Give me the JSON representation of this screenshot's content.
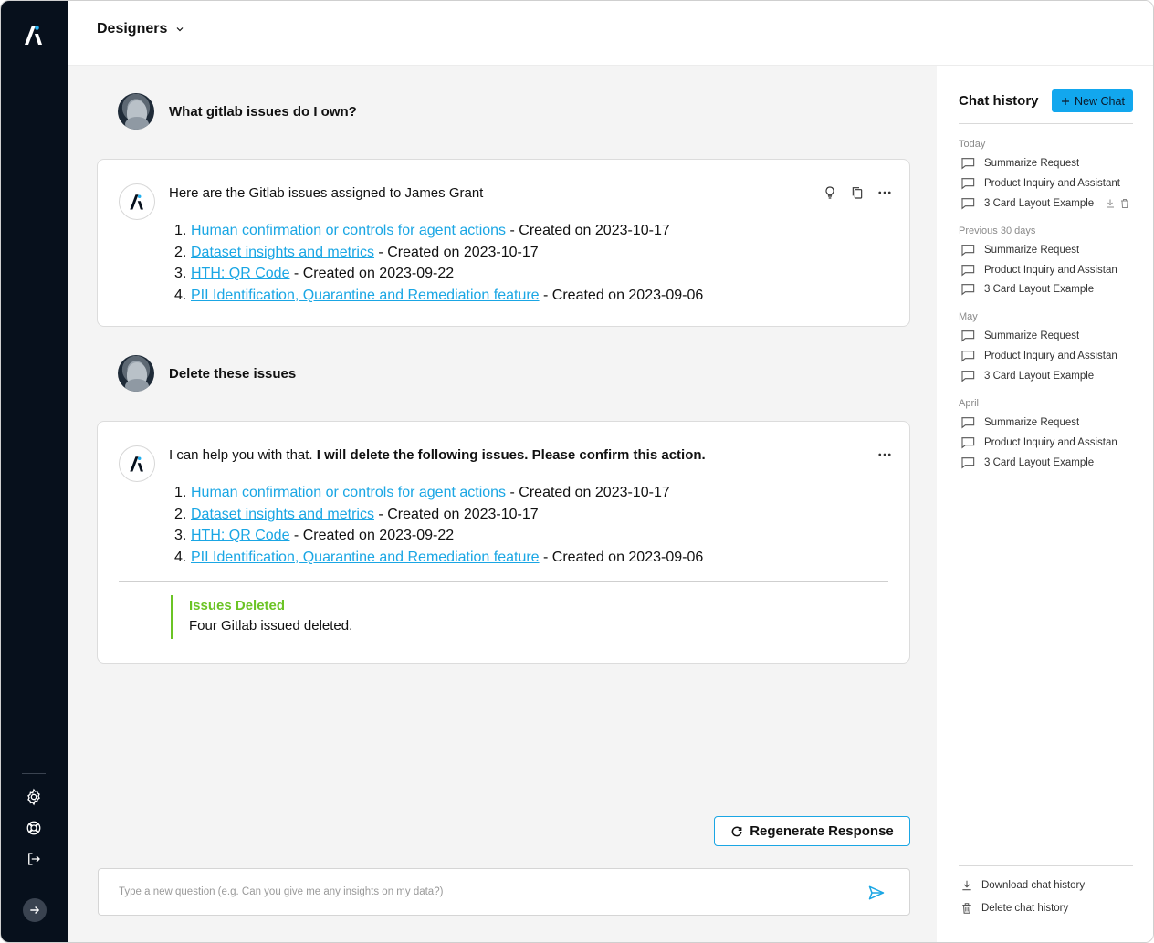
{
  "workspace": {
    "name": "Designers"
  },
  "conversation": {
    "first_question": "What gitlab issues do I own?",
    "first_answer": {
      "lead": "Here are the Gitlab issues assigned to James Grant",
      "issues": [
        {
          "num": "1.",
          "title": "Human confirmation or controls for agent actions",
          "meta": " - Created on 2023-10-17"
        },
        {
          "num": "2.",
          "title": "Dataset insights and metrics",
          "meta": " - Created on 2023-10-17"
        },
        {
          "num": "3.",
          "title": "HTH: QR Code",
          "meta": " - Created on 2023-09-22"
        },
        {
          "num": "4.",
          "title": "PII Identification, Quarantine and Remediation feature",
          "meta": " - Created on 2023-09-06"
        }
      ]
    },
    "second_question": "Delete these issues",
    "second_answer": {
      "lead_plain": "I can help you with that. ",
      "lead_bold": "I will delete the following issues. Please confirm this action.",
      "issues": [
        {
          "num": "1.",
          "title": "Human confirmation or controls for agent actions",
          "meta": " - Created on 2023-10-17"
        },
        {
          "num": "2.",
          "title": "Dataset insights and metrics",
          "meta": " - Created on 2023-10-17"
        },
        {
          "num": "3.",
          "title": "HTH: QR Code",
          "meta": " - Created on 2023-09-22"
        },
        {
          "num": "4.",
          "title": "PII Identification, Quarantine and Remediation feature",
          "meta": " - Created on 2023-09-06"
        }
      ],
      "status_title": "Issues Deleted",
      "status_desc": "Four Gitlab issued deleted."
    }
  },
  "regenerate_label": "Regenerate Response",
  "composer": {
    "placeholder": "Type a new question (e.g. Can you give me any insights on my data?)"
  },
  "sidebar": {
    "title": "Chat history",
    "new_chat_label": "New Chat",
    "groups": [
      {
        "label": "Today",
        "items": [
          "Summarize Request",
          "Product Inquiry and Assistant",
          "3 Card Layout Example"
        ]
      },
      {
        "label": "Previous 30 days",
        "items": [
          "Summarize Request",
          "Product Inquiry and Assistan",
          "3 Card Layout Example"
        ]
      },
      {
        "label": "May",
        "items": [
          "Summarize Request",
          "Product Inquiry and Assistan",
          "3 Card Layout Example"
        ]
      },
      {
        "label": "April",
        "items": [
          "Summarize Request",
          "Product Inquiry and Assistan",
          "3 Card Layout Example"
        ]
      }
    ],
    "download_label": "Download chat history",
    "delete_label": "Delete chat history"
  },
  "colors": {
    "rail": "#07101c",
    "accent": "#1aa6e4",
    "success": "#6bc425",
    "new_chat": "#12a7ee"
  },
  "icons": {
    "rail": [
      "settings-icon",
      "help-lifebuoy-icon",
      "logout-icon",
      "expand-arrow-icon"
    ],
    "answer_actions": [
      "lightbulb-icon",
      "copy-icon",
      "more-icon"
    ]
  }
}
